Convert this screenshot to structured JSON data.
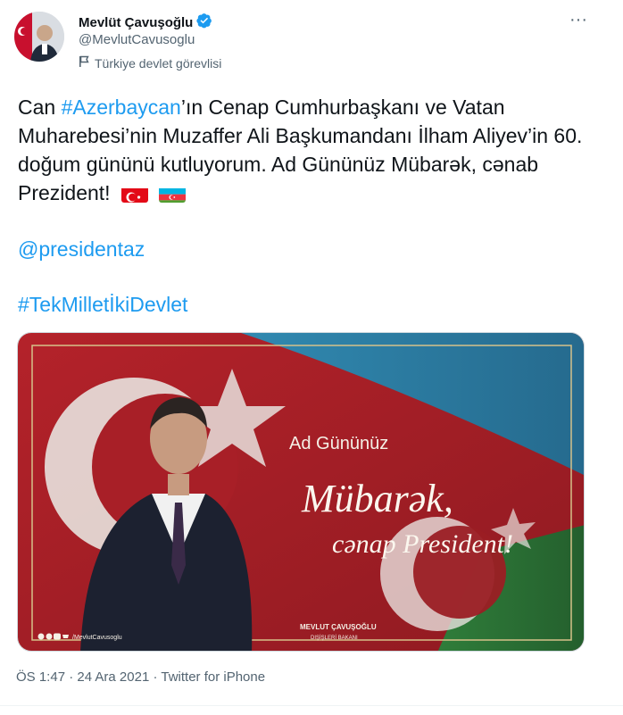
{
  "author": {
    "name": "Mevlüt Çavuşoğlu",
    "handle": "@MevlutCavusoglu",
    "label": "Türkiye devlet görevlisi"
  },
  "tweet": {
    "text_part1": "Can ",
    "hashtag1": "#Azerbaycan",
    "text_part2": "’ın Cenap Cumhurbaşkanı ve Vatan Muharebesi’nin Muzaffer Ali Başkumandanı İlham Aliyev’in 60. doğum gününü kutluyorum. Ad Gününüz Mübarək, cənab Prezident!",
    "mention": "@presidentaz",
    "hashtag2": "#TekMilletİkiDevlet"
  },
  "media": {
    "title_line": "Ad Gününüz",
    "script_line1": "Mübarək,",
    "script_line2": "cənap President!",
    "signature_name": "MEVLUT ÇAVUŞOĞLU",
    "signature_title": "DIŞİŞLERİ BAKANI",
    "social_handle": "/MevlutCavusoglu"
  },
  "meta": {
    "time": "ÖS 1:47",
    "date": "24 Ara 2021",
    "source": "Twitter for iPhone",
    "separator": " · "
  },
  "colors": {
    "link": "#1d9bf0",
    "verified": "#1d9bf0",
    "muted": "#536471"
  },
  "icons": {
    "verified": "verified-badge-icon",
    "label": "flag-icon",
    "more": "more-icon",
    "turkey_flag": "turkey-flag-emoji",
    "azerbaijan_flag": "azerbaijan-flag-emoji"
  }
}
